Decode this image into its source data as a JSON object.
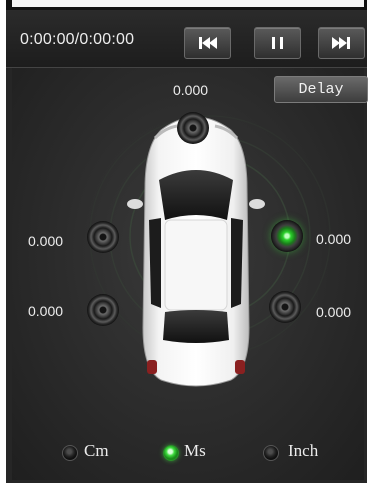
{
  "transport": {
    "time": "0:00:00/0:00:00",
    "prev_icon": "skip-previous-icon",
    "pause_icon": "pause-icon",
    "next_icon": "skip-next-icon"
  },
  "delay_button": {
    "label": "Delay"
  },
  "channels": {
    "top": "0.000",
    "front_left": "0.000",
    "front_right": "0.000",
    "rear_left": "0.000",
    "rear_right": "0.000"
  },
  "active_speaker": "front-right",
  "units": {
    "options": [
      "Cm",
      "Ms",
      "Inch"
    ],
    "selected": "Ms"
  },
  "colors": {
    "active": "#3fdc3f",
    "panel": "#2b2b2b"
  }
}
